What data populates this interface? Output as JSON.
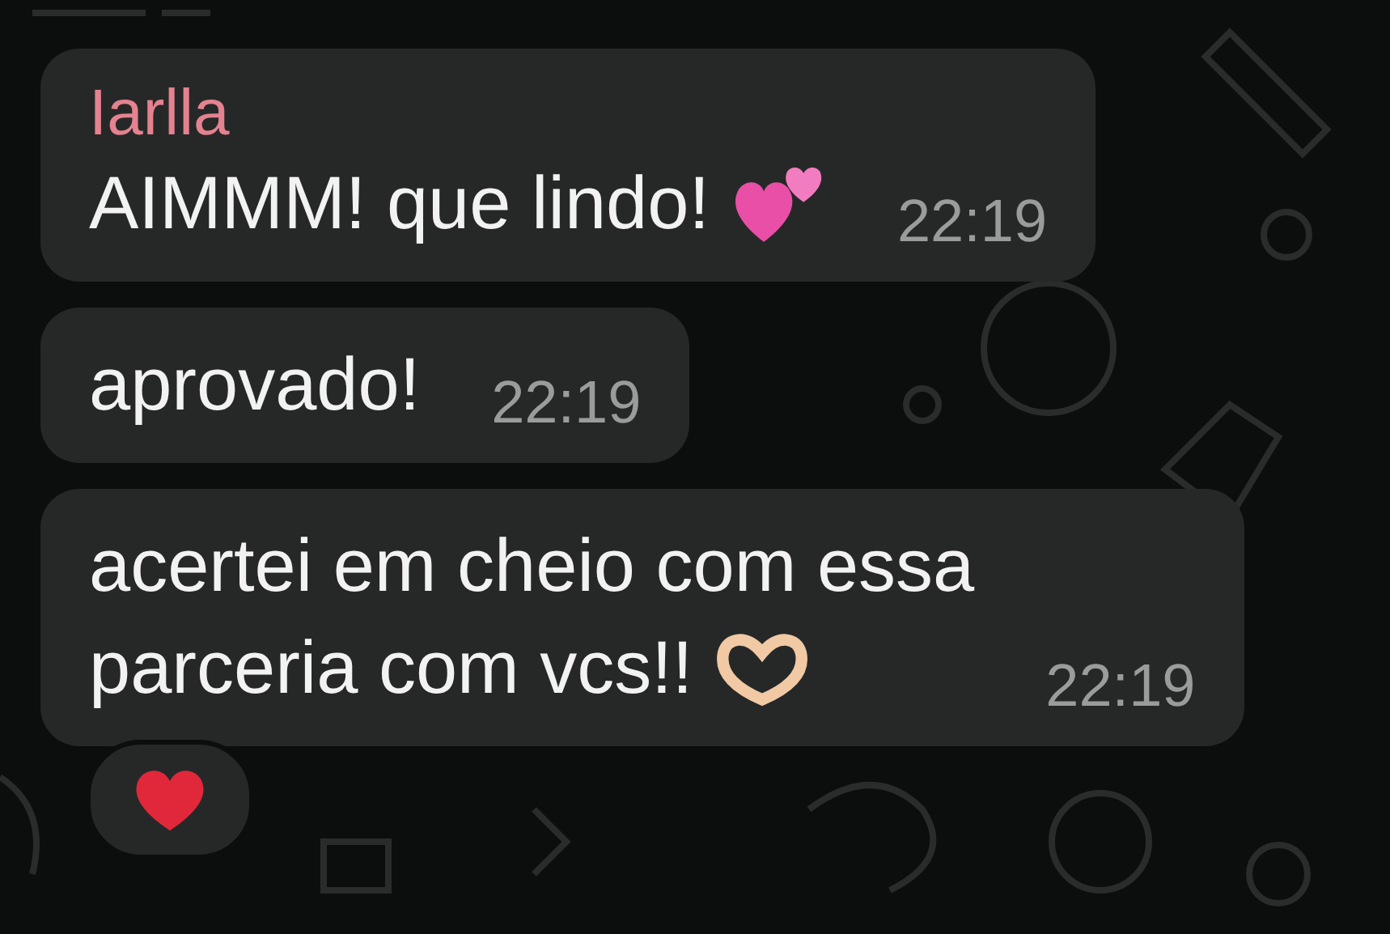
{
  "messages": [
    {
      "sender": "Iarlla",
      "color": "#e5828f",
      "lines": [
        "AIMMM! que lindo!"
      ],
      "emoji": {
        "kind": "two-hearts"
      },
      "time": "22:19"
    },
    {
      "lines": [
        "aprovado!"
      ],
      "time": "22:19"
    },
    {
      "lines": [
        "acertei em cheio com essa",
        "parceria com vcs!!"
      ],
      "emoji": {
        "kind": "heart-hands"
      },
      "time": "22:19",
      "reaction": {
        "kind": "red-heart"
      }
    }
  ]
}
